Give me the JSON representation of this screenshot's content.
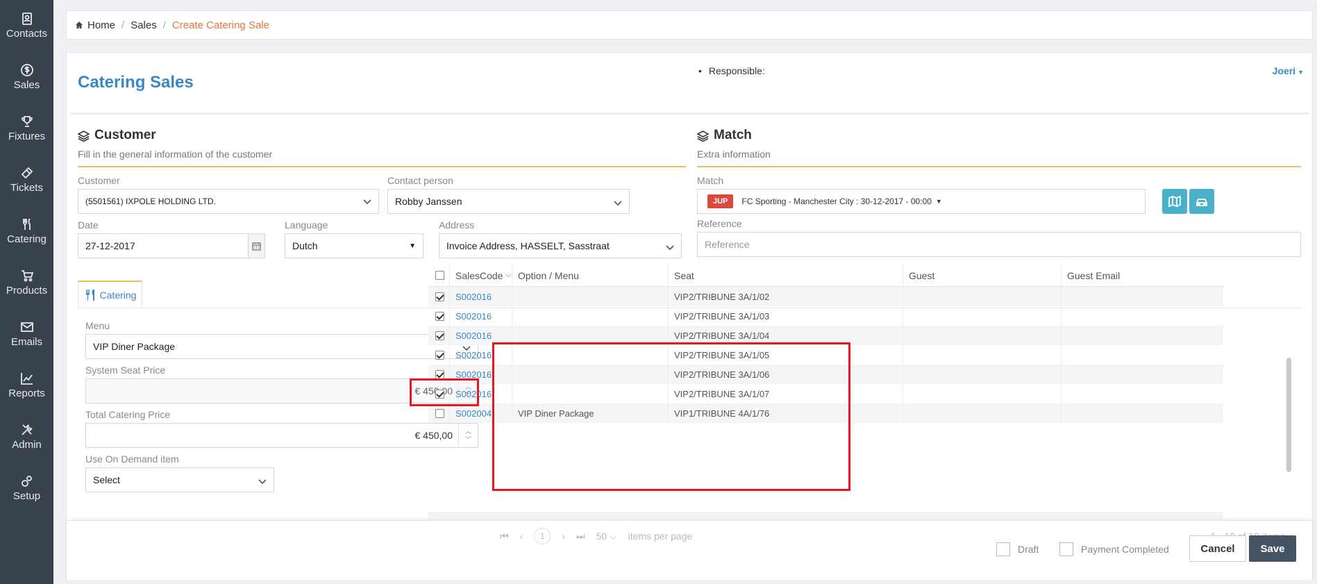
{
  "sidebar": {
    "items": [
      {
        "label": "Contacts",
        "icon": "contacts-icon"
      },
      {
        "label": "Sales",
        "icon": "dollar-icon"
      },
      {
        "label": "Fixtures",
        "icon": "trophy-icon"
      },
      {
        "label": "Tickets",
        "icon": "ticket-icon"
      },
      {
        "label": "Catering",
        "icon": "cutlery-icon"
      },
      {
        "label": "Products",
        "icon": "cart-icon"
      },
      {
        "label": "Emails",
        "icon": "envelope-icon"
      },
      {
        "label": "Reports",
        "icon": "chart-icon"
      },
      {
        "label": "Admin",
        "icon": "tools-icon"
      },
      {
        "label": "Setup",
        "icon": "gears-icon"
      }
    ]
  },
  "breadcrumb": {
    "home": "Home",
    "sales": "Sales",
    "current": "Create Catering Sale"
  },
  "header": {
    "title": "Catering Sales",
    "responsible_label": "Responsible:",
    "user": "Joeri"
  },
  "customer_section": {
    "title": "Customer",
    "subtitle": "Fill in the general information of the customer",
    "customer_label": "Customer",
    "customer_value": "(5501561) IXPOLE HOLDING LTD.",
    "contact_label": "Contact person",
    "contact_value": "Robby Janssen",
    "date_label": "Date",
    "date_value": "27-12-2017",
    "language_label": "Language",
    "language_value": "Dutch",
    "address_label": "Address",
    "address_value": "Invoice Address, HASSELT, Sasstraat"
  },
  "match_section": {
    "title": "Match",
    "subtitle": "Extra information",
    "match_label": "Match",
    "match_badge": "JUP",
    "match_value": "FC Sporting - Manchester City : 30-12-2017 - 00:00",
    "reference_label": "Reference",
    "reference_placeholder": "Reference"
  },
  "tabs": {
    "catering": "Catering"
  },
  "catering_form": {
    "menu_label": "Menu",
    "menu_value": "VIP Diner Package",
    "seat_price_label": "System Seat Price",
    "seat_price_value": "€ 450,00",
    "total_price_label": "Total Catering Price",
    "total_price_value": "€ 450,00",
    "on_demand_label": "Use On Demand item",
    "on_demand_value": "Select"
  },
  "grid": {
    "headers": [
      "SalesCode",
      "Option / Menu",
      "Seat",
      "Guest",
      "Guest Email"
    ],
    "rows": [
      {
        "checked": true,
        "code": "S002016",
        "option": "",
        "seat": "VIP2/TRIBUNE 3A/1/02"
      },
      {
        "checked": true,
        "code": "S002016",
        "option": "",
        "seat": "VIP2/TRIBUNE 3A/1/03"
      },
      {
        "checked": true,
        "code": "S002016",
        "option": "",
        "seat": "VIP2/TRIBUNE 3A/1/04"
      },
      {
        "checked": true,
        "code": "S002016",
        "option": "",
        "seat": "VIP2/TRIBUNE 3A/1/05"
      },
      {
        "checked": true,
        "code": "S002016",
        "option": "",
        "seat": "VIP2/TRIBUNE 3A/1/06"
      },
      {
        "checked": true,
        "code": "S002016",
        "option": "",
        "seat": "VIP2/TRIBUNE 3A/1/07"
      },
      {
        "checked": false,
        "code": "S002004",
        "option": "VIP Diner Package",
        "seat": "VIP1/TRIBUNE 4A/1/76"
      }
    ]
  },
  "pager": {
    "page": "1",
    "page_size": "50",
    "page_size_label": "items per page",
    "summary": "1 - 10 of 10 items"
  },
  "footer": {
    "draft_label": "Draft",
    "payment_label": "Payment Completed",
    "cancel_label": "Cancel",
    "save_label": "Save"
  },
  "colors": {
    "accent": "#3a87c8",
    "breadcrumb_active": "#e8743b",
    "highlight": "#e8161e",
    "sidebar": "#37424c"
  }
}
